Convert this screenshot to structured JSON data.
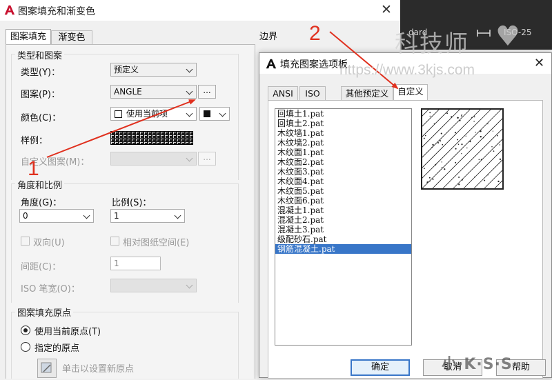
{
  "background_dialog": {
    "title": "图案填充和渐变色",
    "close": "✕",
    "tabs": {
      "hatch": "图案填充",
      "gradient": "渐变色"
    },
    "boundary_label": "边界",
    "toolbar_std": "dard",
    "toolbar_iso": "ISO-25",
    "type_and_pattern": {
      "group_title": "类型和图案",
      "type_label": "类型(Y)：",
      "type_value": "预定义",
      "pattern_label": "图案(P)：",
      "pattern_value": "ANGLE",
      "pattern_browse": "...",
      "color_label": "颜色(C)：",
      "color_value": "使用当前项",
      "sample_label": "样例：",
      "custom_label": "自定义图案(M)：",
      "custom_browse": "..."
    },
    "angle_scale": {
      "group_title": "角度和比例",
      "angle_label": "角度(G)：",
      "angle_value": "0",
      "scale_label": "比例(S)：",
      "scale_value": "1",
      "double_label": "双向(U)",
      "relative_label": "相对图纸空间(E)",
      "spacing_label": "间距(C)：",
      "spacing_value": "1",
      "iso_pen_label": "ISO 笔宽(O)："
    },
    "origin": {
      "group_title": "图案填充原点",
      "use_current": "使用当前原点(T)",
      "specified": "指定的原点",
      "set_new": "单击以设置新原点"
    }
  },
  "palette_dialog": {
    "title": "填充图案选项板",
    "close": "✕",
    "tabs": [
      "ANSI",
      "ISO",
      "其他预定义",
      "自定义"
    ],
    "active_tab": "自定义",
    "patterns": [
      "回填土1.pat",
      "回填土2.pat",
      "木纹墙1.pat",
      "木纹墙2.pat",
      "木纹面1.pat",
      "木纹面2.pat",
      "木纹面3.pat",
      "木纹面4.pat",
      "木纹面5.pat",
      "木纹面6.pat",
      "混凝土1.pat",
      "混凝土2.pat",
      "混凝土3.pat",
      "级配砂石.pat",
      "钢筋混凝土.pat"
    ],
    "selected_pattern": "钢筋混凝土.pat",
    "buttons": {
      "ok": "确定",
      "cancel": "取消",
      "help": "帮助"
    }
  },
  "annotations": {
    "step1": "1",
    "step2": "2",
    "arrow_color": "#e0301e"
  },
  "watermark": {
    "brand": "科技师",
    "url": "https://www.3kjs.com",
    "bottom": "小·K·S·S"
  },
  "colors": {
    "selection": "#3876c8",
    "autocad_red": "#c8102e",
    "dark_toolbar": "#2b2b2b"
  }
}
